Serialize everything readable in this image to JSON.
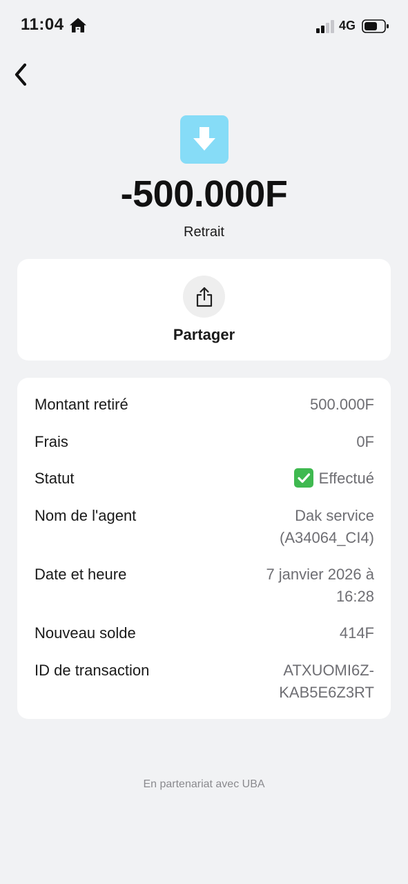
{
  "status_bar": {
    "time": "11:04",
    "network": "4G"
  },
  "header": {
    "back_icon": "chevron-left-icon"
  },
  "transaction": {
    "icon": "arrow-down-icon",
    "icon_color": "#86dcf7",
    "amount": "-500.000F",
    "type": "Retrait"
  },
  "share": {
    "label": "Partager",
    "icon": "share-icon"
  },
  "details": {
    "amount_label": "Montant retiré",
    "amount_value": "500.000F",
    "fees_label": "Frais",
    "fees_value": "0F",
    "status_label": "Statut",
    "status_value": "Effectué",
    "status_icon": "check-mark-icon",
    "status_color": "#3fb950",
    "agent_label": "Nom de l'agent",
    "agent_value_line1": "Dak service",
    "agent_value_line2": "(A34064_CI4)",
    "date_label": "Date et heure",
    "date_value_line1": "7 janvier 2026 à",
    "date_value_line2": "16:28",
    "balance_label": "Nouveau solde",
    "balance_value": "414F",
    "txid_label": "ID de transaction",
    "txid_value_line1": "ATXUOMI6Z-",
    "txid_value_line2": "KAB5E6Z3RT"
  },
  "footer": {
    "partner_text": "En partenariat avec UBA"
  }
}
